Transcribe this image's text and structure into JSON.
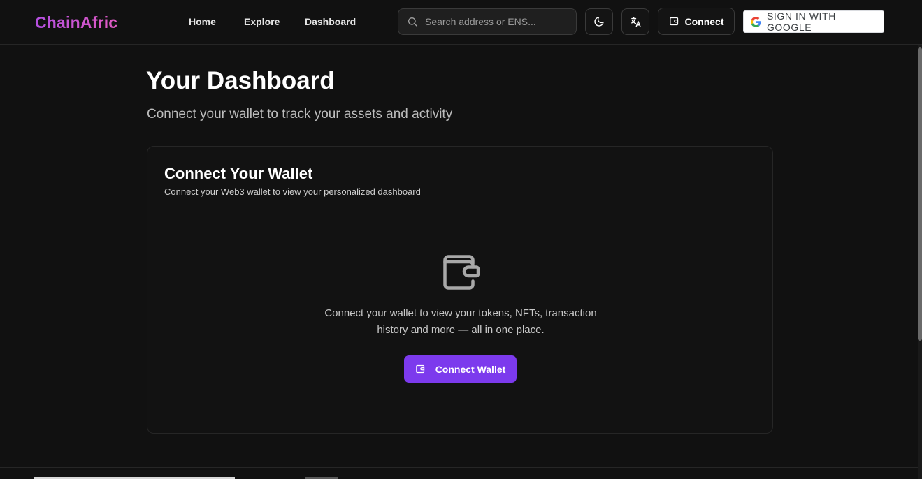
{
  "header": {
    "logo": "ChainAfric",
    "nav": [
      {
        "label": "Home"
      },
      {
        "label": "Explore"
      },
      {
        "label": "Dashboard"
      }
    ],
    "search_placeholder": "Search address or ENS...",
    "connect_label": "Connect",
    "google_label": "SIGN IN WITH GOOGLE",
    "icons": [
      "search-icon",
      "moon-icon",
      "translate-icon",
      "wallet-icon",
      "google-icon"
    ]
  },
  "main": {
    "title": "Your Dashboard",
    "subtitle": "Connect your wallet to track your assets and activity",
    "card": {
      "title": "Connect Your Wallet",
      "description": "Connect your Web3 wallet to view your personalized dashboard",
      "body_line1": "Connect your wallet to view your tokens, NFTs, transaction",
      "body_line2": "history and more — all in one place.",
      "button_label": "Connect Wallet"
    }
  },
  "colors": {
    "background": "#111111",
    "accent": "#7c3aed",
    "logo_gradient_start": "#b44fe0",
    "logo_gradient_end": "#e05ac2"
  }
}
